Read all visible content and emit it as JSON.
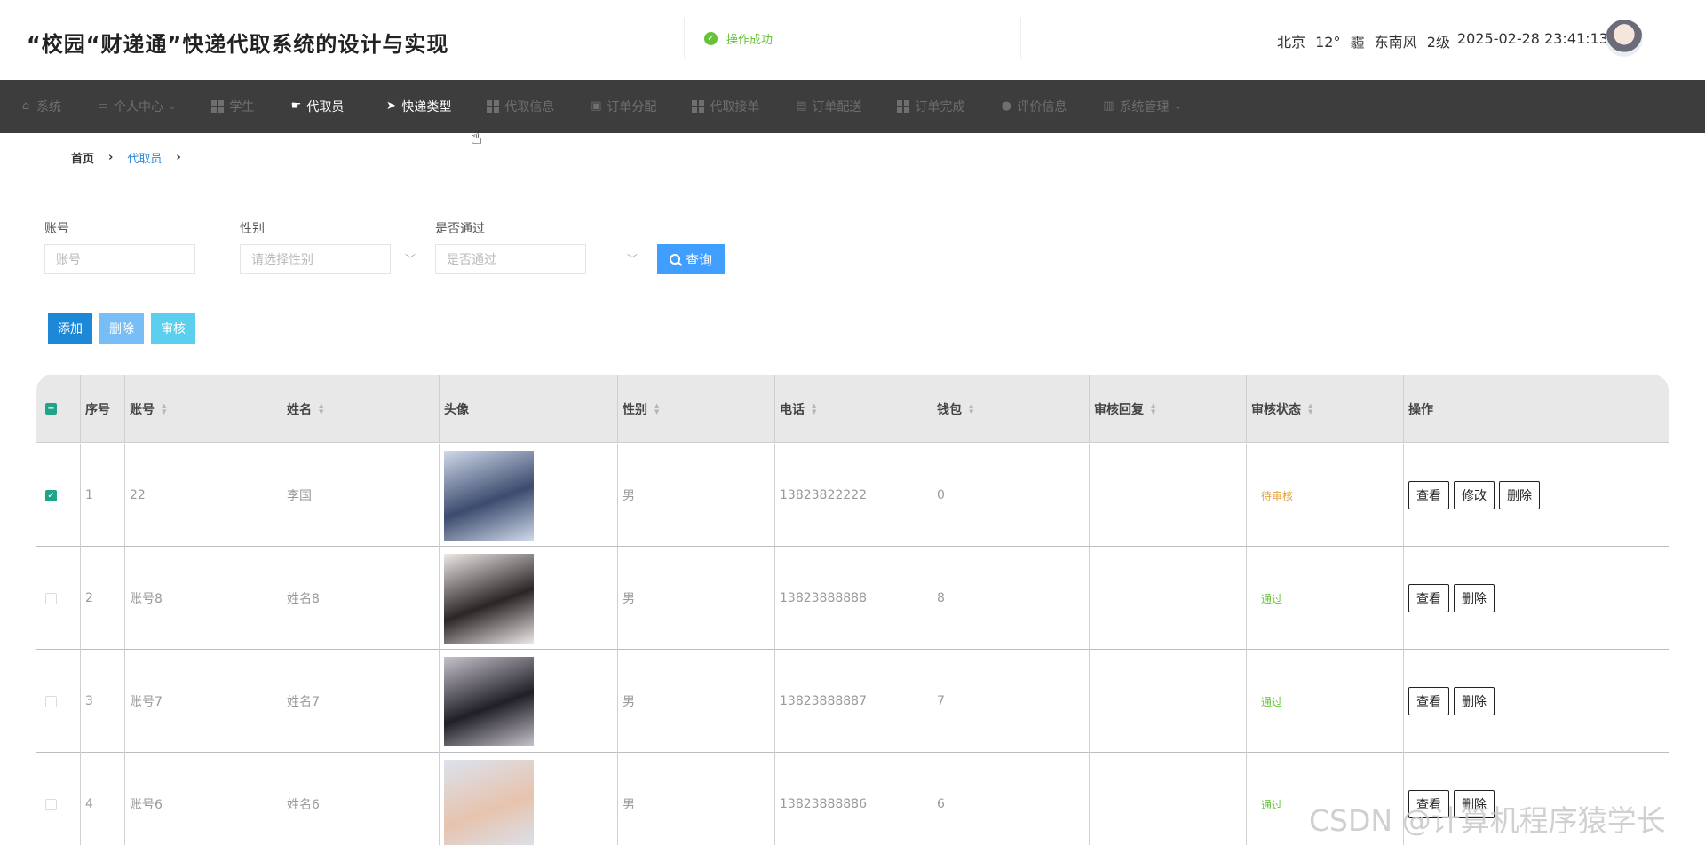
{
  "header": {
    "title": "“校园“财递通”快递代取系统的设计与实现",
    "toast": "操作成功",
    "weather": {
      "city": "北京",
      "temp": "12°",
      "condition": "霾",
      "wind": "东南风",
      "level": "2级"
    },
    "datetime": "2025-02-28 23:41:13"
  },
  "nav": [
    {
      "label": "系统",
      "icon": "home-icon",
      "active": false
    },
    {
      "label": "个人中心",
      "icon": "window-icon",
      "active": false,
      "dropdown": true
    },
    {
      "label": "学生",
      "icon": "grid-icon",
      "active": false
    },
    {
      "label": "代取员",
      "icon": "hand-icon",
      "active": true
    },
    {
      "label": "快递类型",
      "icon": "paper-plane-icon",
      "active": true
    },
    {
      "label": "代取信息",
      "icon": "grid-icon",
      "active": false
    },
    {
      "label": "订单分配",
      "icon": "file-icon",
      "active": false
    },
    {
      "label": "代取接单",
      "icon": "grid-icon",
      "active": false
    },
    {
      "label": "订单配送",
      "icon": "clipboard-icon",
      "active": false
    },
    {
      "label": "订单完成",
      "icon": "grid-icon",
      "active": false
    },
    {
      "label": "评价信息",
      "icon": "user-icon",
      "active": false
    },
    {
      "label": "系统管理",
      "icon": "bar-chart-icon",
      "active": false,
      "dropdown": true
    }
  ],
  "breadcrumb": {
    "home": "首页",
    "current": "代取员"
  },
  "search": {
    "account_label": "账号",
    "account_placeholder": "账号",
    "gender_label": "性别",
    "gender_placeholder": "请选择性别",
    "approved_label": "是否通过",
    "approved_placeholder": "是否通过",
    "search_button": "查询"
  },
  "actions": {
    "add": "添加",
    "delete": "删除",
    "review": "审核"
  },
  "table": {
    "columns": [
      "序号",
      "账号",
      "姓名",
      "头像",
      "性别",
      "电话",
      "钱包",
      "审核回复",
      "审核状态",
      "操作"
    ],
    "rows": [
      {
        "checked": true,
        "index": "1",
        "account": "22",
        "name": "李国",
        "gender": "男",
        "phone": "13823822222",
        "wallet": "0",
        "reply": "",
        "status": "待审核",
        "status_type": "pending",
        "ops": [
          "查看",
          "修改",
          "删除"
        ],
        "photo_colors": [
          "#cfd9ea",
          "#3c4b6e"
        ]
      },
      {
        "checked": false,
        "index": "2",
        "account": "账号8",
        "name": "姓名8",
        "gender": "男",
        "phone": "13823888888",
        "wallet": "8",
        "reply": "",
        "status": "通过",
        "status_type": "pass",
        "ops": [
          "查看",
          "删除"
        ],
        "photo_colors": [
          "#ece8e6",
          "#2b2626"
        ]
      },
      {
        "checked": false,
        "index": "3",
        "account": "账号7",
        "name": "姓名7",
        "gender": "男",
        "phone": "13823888887",
        "wallet": "7",
        "reply": "",
        "status": "通过",
        "status_type": "pass",
        "ops": [
          "查看",
          "删除"
        ],
        "photo_colors": [
          "#c8c2cc",
          "#1f1f26"
        ]
      },
      {
        "checked": false,
        "index": "4",
        "account": "账号6",
        "name": "姓名6",
        "gender": "男",
        "phone": "13823888886",
        "wallet": "6",
        "reply": "",
        "status": "通过",
        "status_type": "pass",
        "ops": [
          "查看",
          "删除"
        ],
        "photo_colors": [
          "#dbe2ee",
          "#e7c3ad"
        ]
      }
    ]
  },
  "watermark": "CSDN @计算机程序猿学长",
  "colors": {
    "nav_bg": "#3d3d3d",
    "primary": "#409eff",
    "add_button": "#1e88d8",
    "delete_button": "#79bdf6",
    "review_button": "#5ccfee",
    "checkbox": "#1fa48a"
  }
}
